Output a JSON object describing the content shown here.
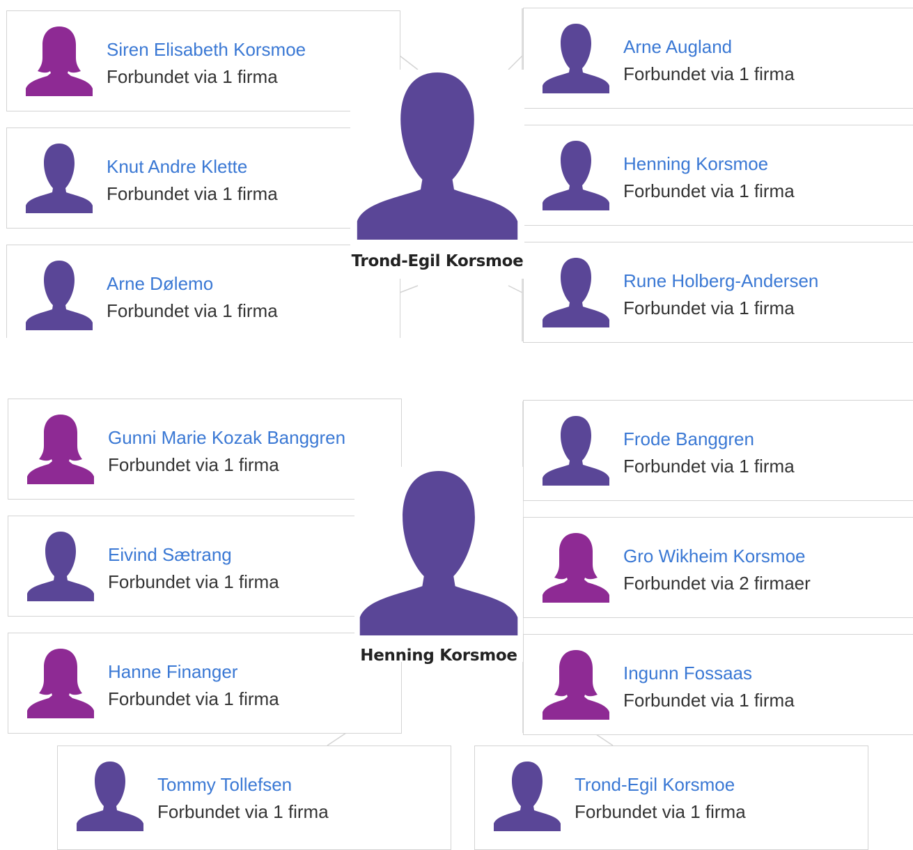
{
  "colors": {
    "link": "#3a78d4",
    "male_avatar": "#5a4697",
    "female_avatar": "#8e2a94",
    "border": "#d3d3d3",
    "subtext": "#333333"
  },
  "network1": {
    "center": {
      "name": "Trond-Egil Korsmoe",
      "icon": "male-person-icon"
    },
    "left": [
      {
        "name": "Siren Elisabeth Korsmoe",
        "sub": "Forbundet via 1 firma",
        "gender": "female"
      },
      {
        "name": "Knut Andre Klette",
        "sub": "Forbundet via 1 firma",
        "gender": "male"
      },
      {
        "name": "Arne Dølemo",
        "sub": "Forbundet via 1 firma",
        "gender": "male"
      }
    ],
    "right": [
      {
        "name": "Arne Augland",
        "sub": "Forbundet via 1 firma",
        "gender": "male"
      },
      {
        "name": "Henning Korsmoe",
        "sub": "Forbundet via 1 firma",
        "gender": "male"
      },
      {
        "name": "Rune Holberg-Andersen",
        "sub": "Forbundet via 1 firma",
        "gender": "male"
      }
    ]
  },
  "network2": {
    "center": {
      "name": "Henning Korsmoe",
      "icon": "male-person-icon"
    },
    "left": [
      {
        "name": "Gunni Marie Kozak Banggren",
        "sub": "Forbundet via 1 firma",
        "gender": "female"
      },
      {
        "name": "Eivind Sætrang",
        "sub": "Forbundet via 1 firma",
        "gender": "male"
      },
      {
        "name": "Hanne Finanger",
        "sub": "Forbundet via 1 firma",
        "gender": "female"
      }
    ],
    "right": [
      {
        "name": "Frode Banggren",
        "sub": "Forbundet via 1 firma",
        "gender": "male"
      },
      {
        "name": "Gro Wikheim Korsmoe",
        "sub": "Forbundet via 2 firmaer",
        "gender": "female"
      },
      {
        "name": "Ingunn Fossaas",
        "sub": "Forbundet via 1 firma",
        "gender": "female"
      }
    ],
    "bottom": [
      {
        "name": "Tommy Tollefsen",
        "sub": "Forbundet via 1 firma",
        "gender": "male"
      },
      {
        "name": "Trond-Egil Korsmoe",
        "sub": "Forbundet via 1 firma",
        "gender": "male"
      }
    ]
  }
}
